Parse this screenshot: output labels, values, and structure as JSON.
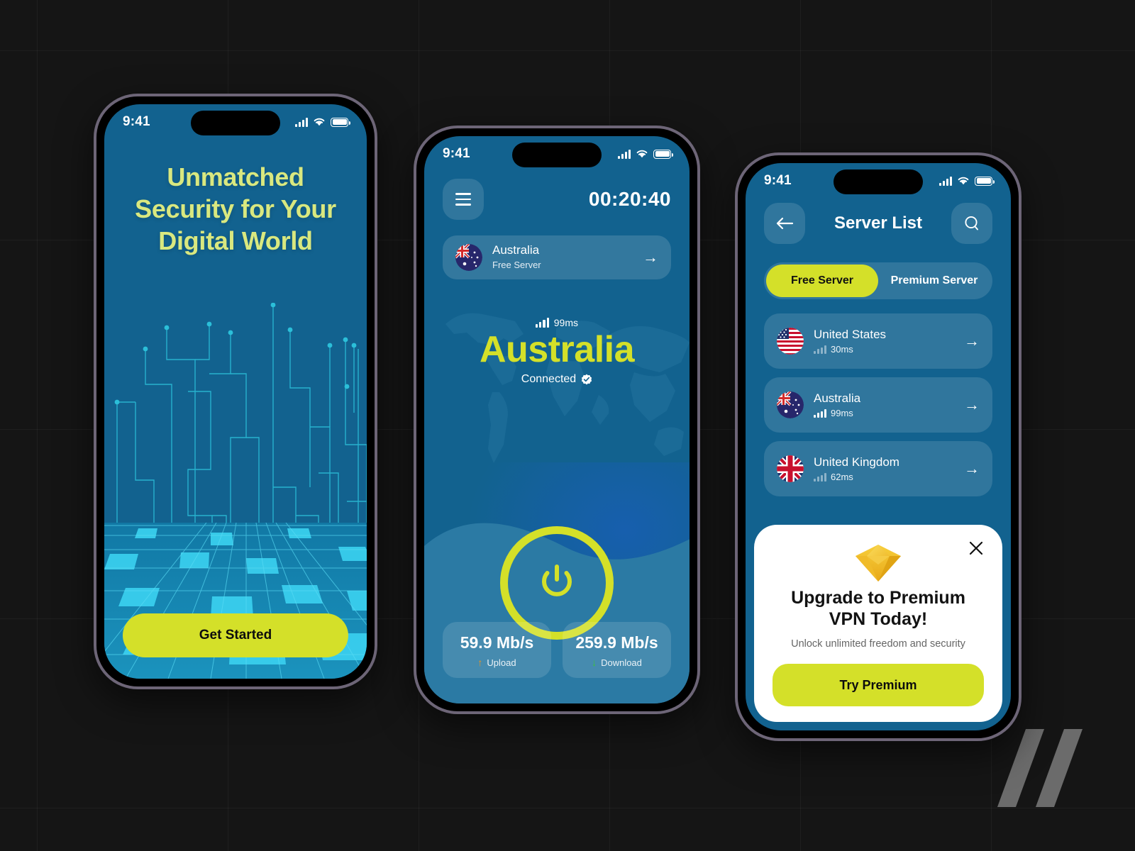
{
  "colors": {
    "brand_blue": "#12628f",
    "accent_lime": "#d4e029",
    "headline_cream": "#d9e87f",
    "card_white": "#ffffff",
    "page_background": "#151515"
  },
  "phone1": {
    "status": {
      "time": "9:41",
      "signal_icon": "cellular-signal-icon",
      "wifi_icon": "wifi-icon",
      "battery_icon": "battery-icon"
    },
    "headline": "Unmatched Security for Your Digital World",
    "headline_lines": [
      "Unmatched",
      "Security for Your",
      "Digital World"
    ],
    "cta_label": "Get Started"
  },
  "phone2": {
    "status": {
      "time": "9:41"
    },
    "menu_icon": "hamburger-menu-icon",
    "timer": "00:20:40",
    "selected_server": {
      "flag": "australia-flag-icon",
      "name": "Australia",
      "type": "Free Server",
      "arrow_icon": "arrow-right-icon"
    },
    "connection": {
      "ping": "99ms",
      "signal_icon": "signal-bars-icon",
      "country": "Australia",
      "status": "Connected",
      "status_icon": "verified-check-icon"
    },
    "power_button_icon": "power-icon",
    "stats": [
      {
        "value": "59.9 Mb/s",
        "label": "Upload",
        "icon": "arrow-up-icon",
        "icon_color": "#f0941c"
      },
      {
        "value": "259.9 Mb/s",
        "label": "Download",
        "icon": "arrow-down-icon",
        "icon_color": "#3dc13d"
      }
    ]
  },
  "phone3": {
    "status": {
      "time": "9:41"
    },
    "back_icon": "arrow-left-icon",
    "title": "Server List",
    "search_icon": "search-icon",
    "tabs": [
      {
        "label": "Free Server",
        "active": true
      },
      {
        "label": "Premium Server",
        "active": false
      }
    ],
    "servers": [
      {
        "flag": "united-states-flag-icon",
        "name": "United States",
        "ping": "30ms",
        "bars": 2,
        "arrow_icon": "arrow-right-icon"
      },
      {
        "flag": "australia-flag-icon",
        "name": "Australia",
        "ping": "99ms",
        "bars": 4,
        "arrow_icon": "arrow-right-icon"
      },
      {
        "flag": "united-kingdom-flag-icon",
        "name": "United Kingdom",
        "ping": "62ms",
        "bars": 3,
        "arrow_icon": "arrow-right-icon"
      }
    ],
    "promo": {
      "close_icon": "close-icon",
      "gem_icon": "diamond-gem-icon",
      "title": "Upgrade to Premium VPN Today!",
      "title_lines": [
        "Upgrade to Premium",
        "VPN Today!"
      ],
      "subtitle": "Unlock unlimited freedom and security",
      "button_label": "Try Premium"
    }
  }
}
